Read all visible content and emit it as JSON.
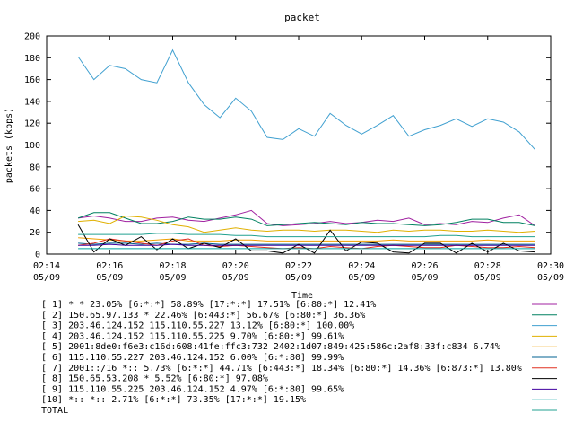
{
  "chart_data": {
    "type": "line",
    "title": "packet",
    "xlabel": "Time",
    "ylabel": "packets (kpps)",
    "ylim": [
      0,
      200
    ],
    "yticks": [
      0,
      20,
      40,
      60,
      80,
      100,
      120,
      140,
      160,
      180,
      200
    ],
    "xrange": [
      "02:14",
      "02:30"
    ],
    "xtick_labels": [
      {
        "time": "02:14",
        "date": "05/09"
      },
      {
        "time": "02:16",
        "date": "05/09"
      },
      {
        "time": "02:18",
        "date": "05/09"
      },
      {
        "time": "02:20",
        "date": "05/09"
      },
      {
        "time": "02:22",
        "date": "05/09"
      },
      {
        "time": "02:24",
        "date": "05/09"
      },
      {
        "time": "02:26",
        "date": "05/09"
      },
      {
        "time": "02:28",
        "date": "05/09"
      },
      {
        "time": "02:30",
        "date": "05/09"
      }
    ],
    "grid": false,
    "legend_position": "bottom",
    "x": [
      "02:15:00",
      "02:15:30",
      "02:16:00",
      "02:16:30",
      "02:17:00",
      "02:17:30",
      "02:18:00",
      "02:18:30",
      "02:19:00",
      "02:19:30",
      "02:20:00",
      "02:20:30",
      "02:21:00",
      "02:21:30",
      "02:22:00",
      "02:22:30",
      "02:23:00",
      "02:23:30",
      "02:24:00",
      "02:24:30",
      "02:25:00",
      "02:25:30",
      "02:26:00",
      "02:26:30",
      "02:27:00",
      "02:27:30",
      "02:28:00",
      "02:28:30",
      "02:29:00",
      "02:29:30"
    ],
    "series": [
      {
        "name": "[ 1] * * 23.05%  [6:*:*] 58.89% [17:*:*] 17.51% [6:80:*] 12.41%",
        "color": "#a020a0",
        "values": [
          33,
          35,
          33,
          30,
          30,
          33,
          34,
          31,
          30,
          33,
          36,
          40,
          28,
          26,
          27,
          28,
          30,
          28,
          29,
          31,
          30,
          33,
          27,
          28,
          27,
          30,
          29,
          33,
          36,
          26
        ]
      },
      {
        "name": "[ 2] 150.65.97.133 * 22.46%  [6:443:*] 56.67% [6:80:*] 36.36%",
        "color": "#008060",
        "values": [
          33,
          38,
          38,
          33,
          28,
          28,
          30,
          34,
          32,
          32,
          34,
          32,
          26,
          27,
          28,
          29,
          28,
          27,
          29,
          28,
          28,
          27,
          26,
          27,
          29,
          32,
          32,
          29,
          29,
          26
        ]
      },
      {
        "name": "[ 3] 203.46.124.152 115.110.55.227 13.12%  [6:80:*] 100.00%",
        "color": "#40a0d0",
        "values": [
          181,
          160,
          173,
          170,
          160,
          157,
          187,
          157,
          137,
          125,
          143,
          131,
          107,
          105,
          115,
          108,
          129,
          118,
          110,
          118,
          127,
          108,
          114,
          118,
          124,
          117,
          124,
          121,
          112,
          96
        ]
      },
      {
        "name": "[ 4] 203.46.124.152 115.110.55.225 9.70%  [6:80:*] 99.61%",
        "color": "#e0b000",
        "values": [
          30,
          31,
          28,
          35,
          34,
          31,
          27,
          25,
          20,
          22,
          24,
          22,
          21,
          22,
          22,
          21,
          22,
          22,
          21,
          20,
          22,
          21,
          22,
          22,
          21,
          21,
          22,
          21,
          20,
          21
        ]
      },
      {
        "name": "[ 5] 2001:8de0:f6e3:c16d:608:41fe:ffc3:732 2402:1d07:849:425:586c:2af8:33f:c834 6.74%",
        "color": "#f0a000",
        "values": [
          15,
          14,
          13,
          12,
          12,
          13,
          14,
          12,
          12,
          12,
          13,
          13,
          12,
          12,
          12,
          12,
          12,
          12,
          12,
          12,
          13,
          12,
          12,
          12,
          12,
          12,
          13,
          12,
          12,
          12
        ]
      },
      {
        "name": "[ 6] 115.110.55.227 203.46.124.152 6.00%  [6:*:80] 99.99%",
        "color": "#006090",
        "values": [
          10,
          9,
          10,
          10,
          9,
          10,
          9,
          9,
          10,
          9,
          9,
          9,
          9,
          9,
          9,
          9,
          9,
          9,
          9,
          9,
          9,
          9,
          9,
          9,
          9,
          9,
          9,
          9,
          9,
          9
        ]
      },
      {
        "name": "[ 7] 2001::/16 *:: 5.73%  [6:*:*] 44.71% [6:443:*] 18.34% [6:80:*] 14.36% [6:873:*] 13.80%",
        "color": "#e03020",
        "values": [
          8,
          10,
          14,
          12,
          10,
          8,
          12,
          14,
          8,
          7,
          8,
          7,
          6,
          5,
          6,
          5,
          7,
          6,
          5,
          7,
          8,
          7,
          6,
          6,
          8,
          7,
          6,
          6,
          7,
          6
        ]
      },
      {
        "name": "[ 8] 150.65.53.208 * 5.52%  [6:80:*] 97.08%",
        "color": "#000000",
        "values": [
          27,
          2,
          14,
          8,
          16,
          4,
          14,
          5,
          10,
          6,
          14,
          3,
          3,
          1,
          9,
          1,
          22,
          3,
          11,
          10,
          2,
          1,
          10,
          10,
          1,
          10,
          2,
          10,
          3,
          2
        ]
      },
      {
        "name": "[ 9] 115.110.55.225 203.46.124.152 4.97%  [6:*:80] 99.65%",
        "color": "#4000a0",
        "values": [
          8,
          8,
          9,
          8,
          8,
          8,
          9,
          8,
          8,
          8,
          8,
          8,
          8,
          8,
          8,
          8,
          8,
          8,
          8,
          8,
          8,
          8,
          8,
          8,
          8,
          8,
          8,
          8,
          8,
          8
        ]
      },
      {
        "name": "[10] *:: *:: 2.71%  [6:*:*] 73.35% [17:*:*] 19.15%",
        "color": "#00a0a0",
        "values": [
          5,
          5,
          5,
          5,
          5,
          5,
          5,
          5,
          5,
          5,
          5,
          5,
          5,
          5,
          5,
          5,
          5,
          5,
          5,
          5,
          5,
          5,
          5,
          5,
          5,
          5,
          5,
          5,
          5,
          5
        ]
      },
      {
        "name": "TOTAL",
        "color": "#20a090",
        "values": [
          18,
          18,
          18,
          18,
          18,
          19,
          19,
          18,
          18,
          18,
          17,
          17,
          16,
          16,
          16,
          16,
          16,
          16,
          16,
          16,
          16,
          16,
          16,
          17,
          17,
          16,
          16,
          16,
          16,
          16
        ]
      }
    ]
  }
}
